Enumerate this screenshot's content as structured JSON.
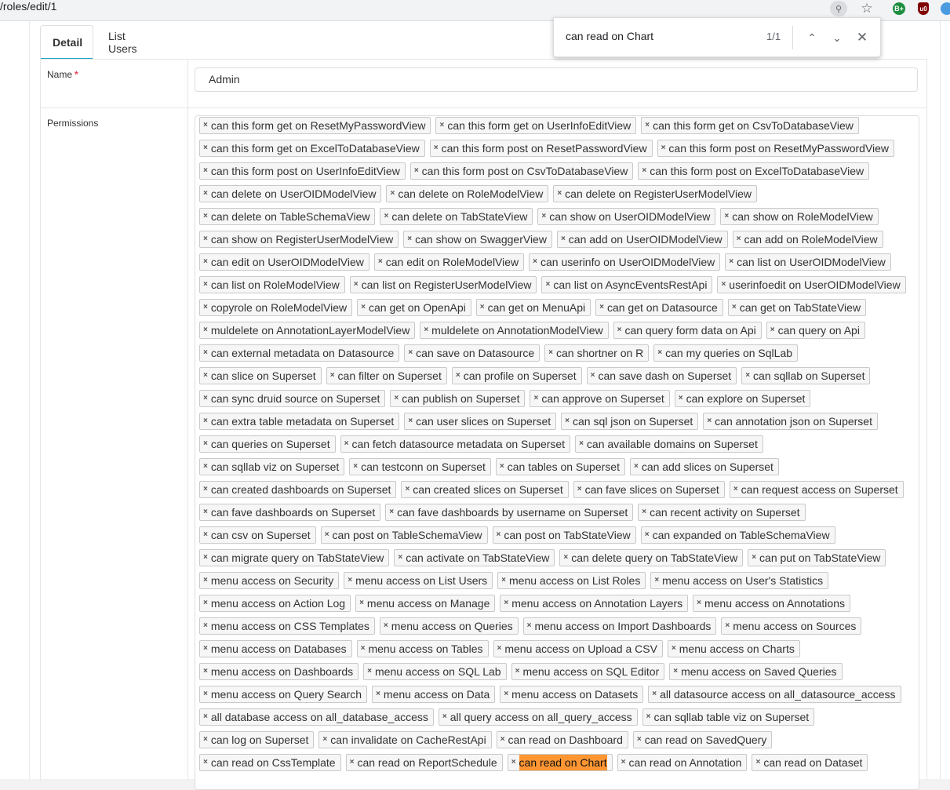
{
  "browser": {
    "url": "/roles/edit/1",
    "find": {
      "query": "can read on Chart",
      "count": "1/1"
    }
  },
  "tabs": [
    {
      "label": "Detail"
    },
    {
      "label": "List Users"
    }
  ],
  "form": {
    "name_label": "Name",
    "required_mark": "*",
    "name_value": "Admin",
    "permissions_label": "Permissions"
  },
  "permission_rows": [
    [
      "can this form get on ResetMyPasswordView",
      "can this form get on UserInfoEditView",
      "can this form get on CsvToDatabaseView"
    ],
    [
      "can this form get on ExcelToDatabaseView",
      "can this form post on ResetPasswordView",
      "can this form post on ResetMyPasswordView"
    ],
    [
      "can this form post on UserInfoEditView",
      "can this form post on CsvToDatabaseView",
      "can this form post on ExcelToDatabaseView"
    ],
    [
      "can delete on UserOIDModelView",
      "can delete on RoleModelView",
      "can delete on RegisterUserModelView"
    ],
    [
      "can delete on TableSchemaView",
      "can delete on TabStateView",
      "can show on UserOIDModelView",
      "can show on RoleModelView"
    ],
    [
      "can show on RegisterUserModelView",
      "can show on SwaggerView",
      "can add on UserOIDModelView",
      "can add on RoleModelView"
    ],
    [
      "can edit on UserOIDModelView",
      "can edit on RoleModelView",
      "can userinfo on UserOIDModelView",
      "can list on UserOIDModelView"
    ],
    [
      "can list on RoleModelView",
      "can list on RegisterUserModelView",
      "can list on AsyncEventsRestApi",
      "userinfoedit on UserOIDModelView"
    ],
    [
      "copyrole on RoleModelView",
      "can get on OpenApi",
      "can get on MenuApi",
      "can get on Datasource",
      "can get on TabStateView"
    ],
    [
      "muldelete on AnnotationLayerModelView",
      "muldelete on AnnotationModelView",
      "can query form data on Api",
      "can query on Api"
    ],
    [
      "can external metadata on Datasource",
      "can save on Datasource",
      "can shortner on R",
      "can my queries on SqlLab"
    ],
    [
      "can slice on Superset",
      "can filter on Superset",
      "can profile on Superset",
      "can save dash on Superset",
      "can sqllab on Superset"
    ],
    [
      "can sync druid source on Superset",
      "can publish on Superset",
      "can approve on Superset",
      "can explore on Superset"
    ],
    [
      "can extra table metadata on Superset",
      "can user slices on Superset",
      "can sql json on Superset",
      "can annotation json on Superset"
    ],
    [
      "can queries on Superset",
      "can fetch datasource metadata on Superset",
      "can available domains on Superset"
    ],
    [
      "can sqllab viz on Superset",
      "can testconn on Superset",
      "can tables on Superset",
      "can add slices on Superset"
    ],
    [
      "can created dashboards on Superset",
      "can created slices on Superset",
      "can fave slices on Superset",
      "can request access on Superset"
    ],
    [
      "can fave dashboards on Superset",
      "can fave dashboards by username on Superset",
      "can recent activity on Superset"
    ],
    [
      "can csv on Superset",
      "can post on TableSchemaView",
      "can post on TabStateView",
      "can expanded on TableSchemaView"
    ],
    [
      "can migrate query on TabStateView",
      "can activate on TabStateView",
      "can delete query on TabStateView",
      "can put on TabStateView"
    ],
    [
      "menu access on Security",
      "menu access on List Users",
      "menu access on List Roles",
      "menu access on User's Statistics"
    ],
    [
      "menu access on Action Log",
      "menu access on Manage",
      "menu access on Annotation Layers",
      "menu access on Annotations"
    ],
    [
      "menu access on CSS Templates",
      "menu access on Queries",
      "menu access on Import Dashboards",
      "menu access on Sources"
    ],
    [
      "menu access on Databases",
      "menu access on Tables",
      "menu access on Upload a CSV",
      "menu access on Charts"
    ],
    [
      "menu access on Dashboards",
      "menu access on SQL Lab",
      "menu access on SQL Editor",
      "menu access on Saved Queries"
    ],
    [
      "menu access on Query Search",
      "menu access on Data",
      "menu access on Datasets",
      "all datasource access on all_datasource_access"
    ],
    [
      "all database access on all_database_access",
      "all query access on all_query_access",
      "can sqllab table viz on Superset"
    ],
    [
      "can log on Superset",
      "can invalidate on CacheRestApi",
      "can read on Dashboard",
      "can read on SavedQuery"
    ],
    [
      "can read on CssTemplate",
      "can read on ReportSchedule",
      "can read on Chart",
      "can read on Annotation",
      "can read on Dataset"
    ]
  ],
  "highlight": {
    "row": 28,
    "index": 2,
    "color": "#ff9632"
  }
}
